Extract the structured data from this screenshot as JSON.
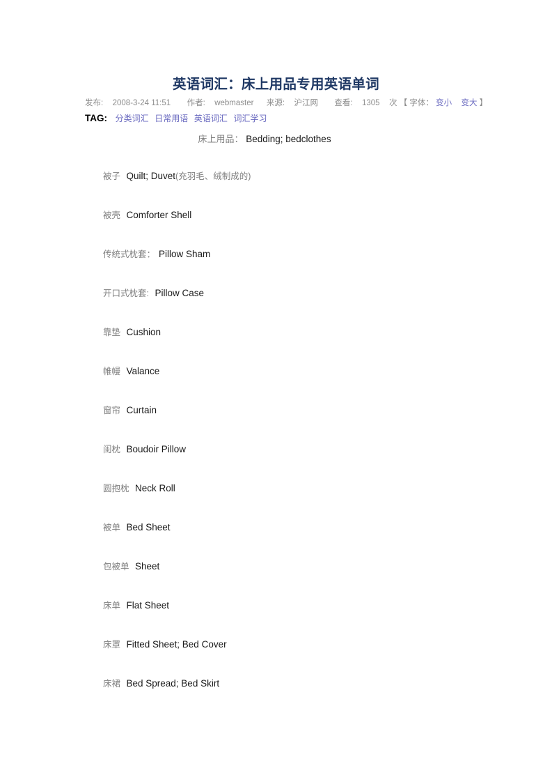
{
  "article": {
    "title": "英语词汇：床上用品专用英语单词",
    "title_color": "#1f3864",
    "meta": {
      "publish_label": "发布:",
      "publish_date": "2008-3-24 11:51",
      "author_label": "作者:",
      "author": "webmaster",
      "source_label": "来源:",
      "source": "沪江网",
      "views_label": "查看:",
      "views_count": "1305",
      "views_unit": "次",
      "bracket_open": "【",
      "font_label": "字体：",
      "font_smaller": "变小",
      "font_larger": "变大",
      "bracket_close": "】",
      "text_color": "#8c8c8c",
      "link_color": "#6a6ac0"
    },
    "tag": {
      "label": "TAG:",
      "items": [
        "分类词汇",
        "日常用语",
        "英语词汇",
        "词汇学习"
      ],
      "link_color": "#6a6ac0"
    },
    "subtitle": {
      "cn": "床上用品：",
      "en": "Bedding; bedclothes"
    },
    "entries": [
      {
        "cn": "被子",
        "sep": " ",
        "en": "Quilt; Duvet",
        "paren": "(充羽毛、绒制成的)"
      },
      {
        "cn": "被壳",
        "sep": " ",
        "en": "Comforter Shell",
        "paren": ""
      },
      {
        "cn": "传统式枕套",
        "sep": "：",
        "en": "Pillow Sham",
        "paren": ""
      },
      {
        "cn": "开口式枕套",
        "sep": ": ",
        "en": "Pillow Case",
        "paren": ""
      },
      {
        "cn": "靠垫",
        "sep": " ",
        "en": "Cushion",
        "paren": ""
      },
      {
        "cn": "帷幔",
        "sep": " ",
        "en": "Valance",
        "paren": ""
      },
      {
        "cn": "窗帘",
        "sep": " ",
        "en": "Curtain",
        "paren": ""
      },
      {
        "cn": "闺枕",
        "sep": " ",
        "en": "Boudoir Pillow",
        "paren": ""
      },
      {
        "cn": "圆抱枕",
        "sep": " ",
        "en": "Neck Roll",
        "paren": ""
      },
      {
        "cn": "被单",
        "sep": " ",
        "en": "Bed Sheet",
        "paren": ""
      },
      {
        "cn": "包被单",
        "sep": " ",
        "en": "Sheet",
        "paren": ""
      },
      {
        "cn": "床单",
        "sep": " ",
        "en": "Flat Sheet",
        "paren": ""
      },
      {
        "cn": "床罩",
        "sep": " ",
        "en": "Fitted Sheet; Bed Cover",
        "paren": ""
      },
      {
        "cn": "床裙",
        "sep": " ",
        "en": "Bed Spread; Bed Skirt",
        "paren": ""
      }
    ]
  }
}
